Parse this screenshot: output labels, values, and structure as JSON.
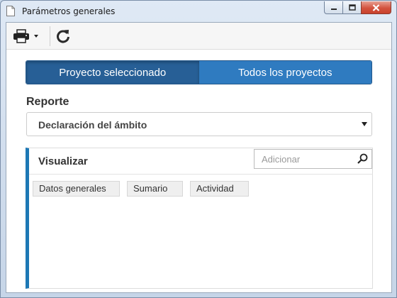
{
  "window": {
    "title": "Parámetros generales"
  },
  "toolbar": {
    "print_icon": "printer-icon",
    "refresh_icon": "refresh-icon"
  },
  "scope_tabs": [
    {
      "label": "Proyecto seleccionado",
      "active": true
    },
    {
      "label": "Todos los proyectos",
      "active": false
    }
  ],
  "report": {
    "label": "Reporte",
    "selected": "Declaración del ámbito"
  },
  "visualizar": {
    "title": "Visualizar",
    "search_placeholder": "Adicionar",
    "chips": [
      "Datos generales",
      "Sumario",
      "Actividad"
    ]
  },
  "colors": {
    "active_tab": "#275f96",
    "inactive_tab": "#2f7bc0",
    "panel_accent": "#1d78b5"
  }
}
